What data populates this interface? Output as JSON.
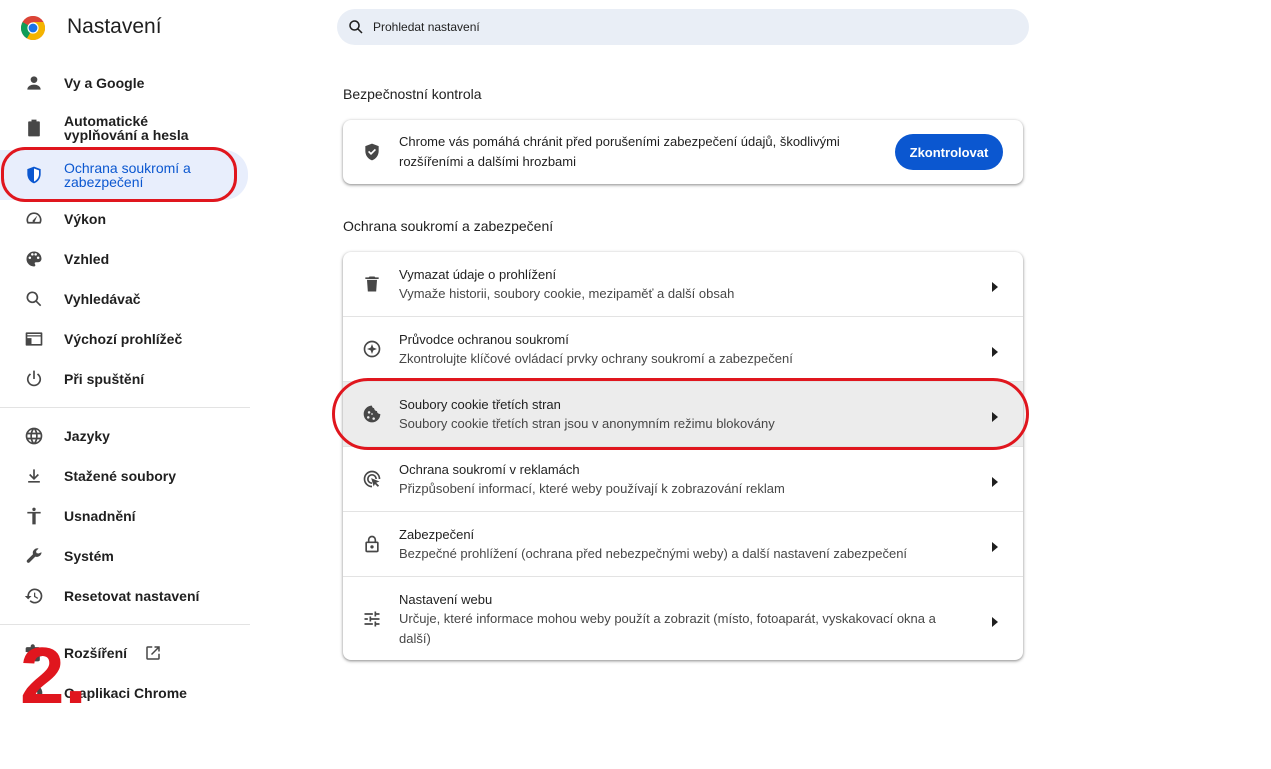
{
  "app": {
    "title": "Nastavení"
  },
  "search": {
    "placeholder": "Prohledat nastavení"
  },
  "sidebar": {
    "items": [
      {
        "label": "Vy a Google",
        "icon": "person-icon"
      },
      {
        "label": "Automatické vyplňování a hesla",
        "icon": "clipboard-icon"
      },
      {
        "label": "Ochrana soukromí a zabezpečení",
        "icon": "shield-icon",
        "active": true
      },
      {
        "label": "Výkon",
        "icon": "speedometer-icon"
      },
      {
        "label": "Vzhled",
        "icon": "palette-icon"
      },
      {
        "label": "Vyhledávač",
        "icon": "search-icon"
      },
      {
        "label": "Výchozí prohlížeč",
        "icon": "browser-window-icon"
      },
      {
        "label": "Při spuštění",
        "icon": "power-icon"
      },
      {
        "label": "Jazyky",
        "icon": "globe-icon"
      },
      {
        "label": "Stažené soubory",
        "icon": "download-icon"
      },
      {
        "label": "Usnadnění",
        "icon": "accessibility-icon"
      },
      {
        "label": "Systém",
        "icon": "wrench-icon"
      },
      {
        "label": "Resetovat nastavení",
        "icon": "history-icon"
      },
      {
        "label": "Rozšíření",
        "icon": "puzzle-icon"
      },
      {
        "label": "O aplikaci Chrome",
        "icon": "chrome-icon"
      }
    ]
  },
  "safety_check": {
    "section_title": "Bezpečnostní kontrola",
    "text": "Chrome vás pomáhá chránit před porušeními zabezpečení údajů, škodlivými rozšířeními a dalšími hrozbami",
    "button_label": "Zkontrolovat",
    "icon": "shield-check-icon"
  },
  "privacy": {
    "section_title": "Ochrana soukromí a zabezpečení",
    "rows": [
      {
        "title": "Vymazat údaje o prohlížení",
        "subtitle": "Vymaže historii, soubory cookie, mezipaměť a další obsah",
        "icon": "trash-icon"
      },
      {
        "title": "Průvodce ochranou soukromí",
        "subtitle": "Zkontrolujte klíčové ovládací prvky ochrany soukromí a zabezpečení",
        "icon": "compass-icon"
      },
      {
        "title": "Soubory cookie třetích stran",
        "subtitle": "Soubory cookie třetích stran jsou v anonymním režimu blokovány",
        "icon": "cookie-icon",
        "highlighted": true
      },
      {
        "title": "Ochrana soukromí v reklamách",
        "subtitle": "Přizpůsobení informací, které weby používají k zobrazování reklam",
        "icon": "ads-privacy-icon"
      },
      {
        "title": "Zabezpečení",
        "subtitle": "Bezpečné prohlížení (ochrana před nebezpečnými weby) a další nastavení zabezpečení",
        "icon": "lock-icon"
      },
      {
        "title": "Nastavení webu",
        "subtitle": "Určuje, které informace mohou weby použít a zobrazit (místo, fotoaparát, vyskakovací okna a další)",
        "icon": "sliders-icon"
      }
    ]
  },
  "annotation": {
    "step_number": "2.",
    "color": "#e0161e"
  },
  "colors": {
    "accent": "#0b57d0",
    "active_bg": "#e8eefc",
    "search_bg": "#e9eef6",
    "annotation": "#e0161e"
  }
}
